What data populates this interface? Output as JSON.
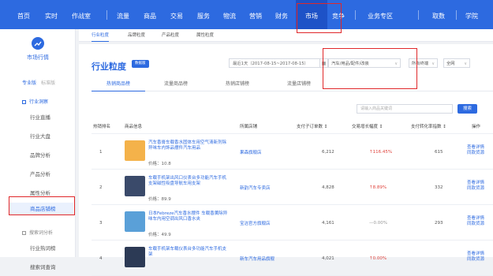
{
  "topnav": {
    "items": [
      "首页",
      "实时",
      "作战室",
      "流量",
      "商品",
      "交易",
      "服务",
      "物流",
      "营销",
      "财务",
      "市场",
      "竞争",
      "业务专区",
      "取数",
      "学院"
    ],
    "active": "市场"
  },
  "colors": {
    "brand": "#2d6ae0",
    "highlight": "#e0282a",
    "up": "#e0443d"
  },
  "sidebar": {
    "icon": "chart-circle-icon",
    "title": "市场行情",
    "mode_on": "专业版",
    "mode_off": "标准版",
    "section1": "行业洞察",
    "items": [
      "行业直播",
      "行业大盘",
      "品牌分析",
      "产品分析",
      "属性分析",
      "商品店铺榜"
    ],
    "section2": "搜索词分析",
    "items2": [
      "行业热词榜",
      "搜索词查询"
    ]
  },
  "subtabs": [
    "行业粒度",
    "品牌粒度",
    "产品粒度",
    "属性粒度"
  ],
  "panel": {
    "title": "行业粒度",
    "badge": "数据版",
    "date_range": "最近1天（2017-08-15~2017-08-15）",
    "category": "汽车/用品/配件/改装",
    "terminal": "所有终端",
    "region": "全网",
    "tabs": [
      "热销商品榜",
      "流量商品榜",
      "热销店铺榜",
      "流量店铺榜"
    ],
    "search_placeholder": "请输入商品关键词",
    "search_button": "搜索"
  },
  "table": {
    "headers": [
      "热销排名",
      "商品信息",
      "所属店铺",
      "支付子订单数 ↕",
      "交易增长幅度 ↕",
      "支付转化率指数 ↕",
      "操作"
    ],
    "op_detail": "查看详情",
    "op_monitor": "同款货源",
    "rows": [
      {
        "rank": "1",
        "name": "汽车香膏车载香水固体车用空气清新剂除异味车内饰品摆件汽车用品",
        "price": "价格：10.8",
        "shop": "果森旗舰店",
        "orders": "6,212",
        "growth": "↑116.45%",
        "growth_type": "up",
        "conv": "615",
        "thumb": "#f4b24a"
      },
      {
        "rank": "2",
        "name": "车载手机架出风口仪表台多功能汽车手机支架磁性吸盘导航车用支架",
        "price": "价格：89.9",
        "shop": "新韵汽车专卖店",
        "orders": "4,828",
        "growth": "↑8.89%",
        "growth_type": "up",
        "conv": "332",
        "thumb": "#3a4a6a"
      },
      {
        "rank": "3",
        "name": "日本Febreze汽车香水摆件 车载香薰除异味车内用空调出风口香水夹",
        "price": "价格：49.9",
        "shop": "宝洁官方旗舰店",
        "orders": "4,161",
        "growth": "—0.00%",
        "growth_type": "flat",
        "conv": "293",
        "thumb": "#5aa0d8"
      },
      {
        "rank": "4",
        "name": "车载手机架车载仪表台多功能汽车手机支架",
        "price": "",
        "shop": "新车汽车用品旗舰",
        "orders": "4,021",
        "growth": "↑0.00%",
        "growth_type": "up",
        "conv": "",
        "thumb": "#2c3a55"
      }
    ]
  }
}
